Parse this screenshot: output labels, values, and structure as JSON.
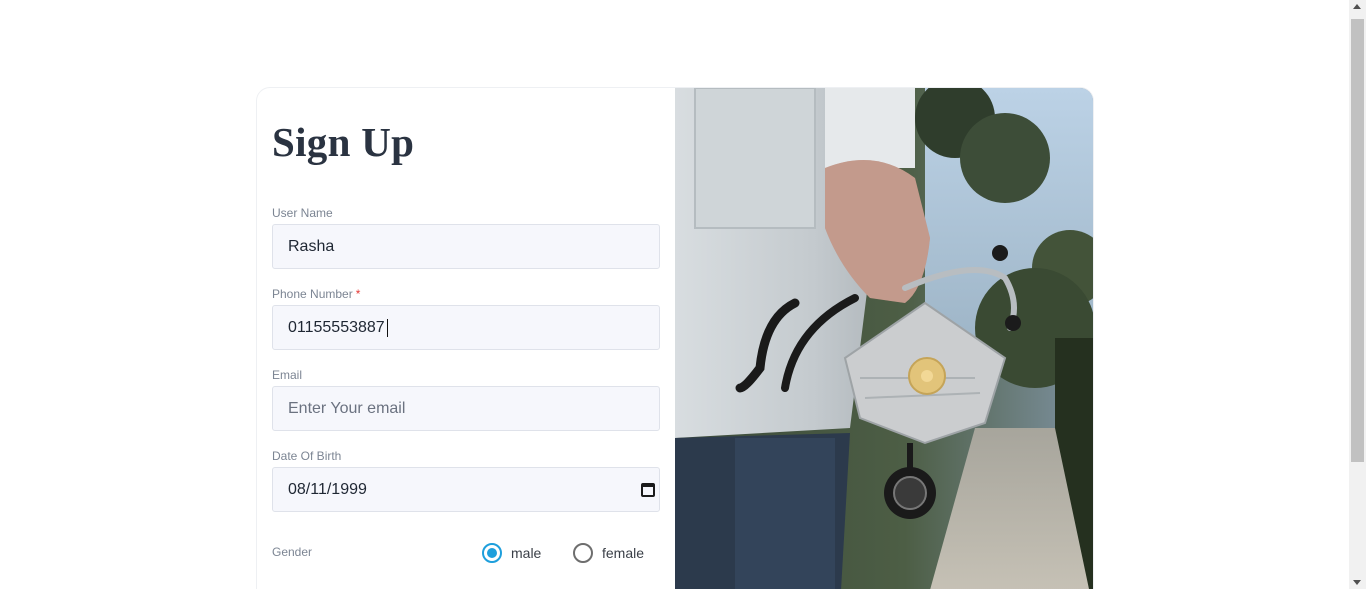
{
  "form": {
    "title": "Sign Up",
    "username": {
      "label": "User Name",
      "value": "Rasha"
    },
    "phone": {
      "label": "Phone Number",
      "required_mark": "*",
      "value": "01155553887"
    },
    "email": {
      "label": "Email",
      "placeholder": "Enter Your email",
      "value": ""
    },
    "dob": {
      "label": "Date Of Birth",
      "value": "08/11/1999",
      "icon": "calendar-icon"
    },
    "gender": {
      "label": "Gender",
      "options": [
        {
          "label": "male",
          "checked": true
        },
        {
          "label": "female",
          "checked": false
        }
      ]
    }
  },
  "image": {
    "subject": "doctor holding stethoscope and face mask"
  },
  "colors": {
    "accent": "#1e9fdc",
    "input_bg": "#f6f7fc",
    "title": "#2a3341",
    "required": "#e53935"
  }
}
